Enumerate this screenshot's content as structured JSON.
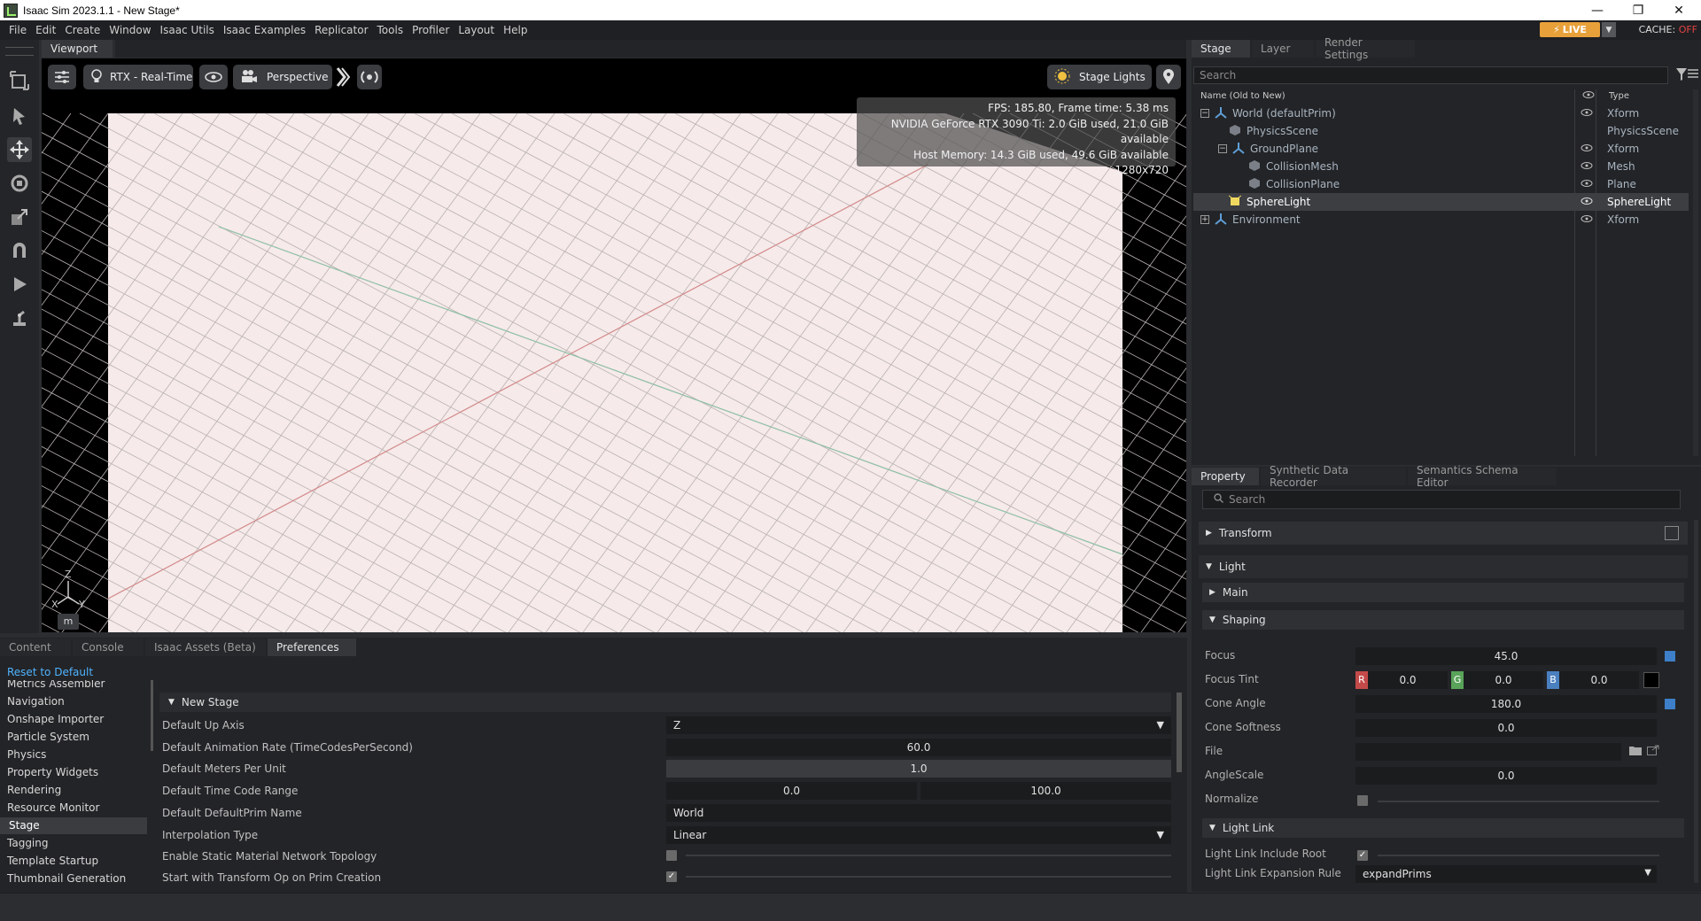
{
  "window": {
    "title": "Isaac Sim 2023.1.1 - New Stage*",
    "minimize": "—",
    "maximize": "❐",
    "close": "✕"
  },
  "menu": [
    "File",
    "Edit",
    "Create",
    "Window",
    "Isaac Utils",
    "Isaac Examples",
    "Replicator",
    "Tools",
    "Profiler",
    "Layout",
    "Help"
  ],
  "status": {
    "live": "LIVE",
    "cache_label": "CACHE:",
    "cache_state": "OFF"
  },
  "viewport": {
    "tab": "Viewport",
    "renderer": "RTX - Real-Time",
    "camera": "Perspective",
    "lights": "Stage Lights",
    "hud": {
      "fps": "FPS: 185.80, Frame time: 5.38 ms",
      "gpu": "NVIDIA GeForce RTX 3090 Ti: 2.0 GiB used, 21.0 GiB available",
      "host": "Host Memory: 14.3 GiB used, 49.6 GiB available",
      "resolution": "1280x720"
    },
    "axis": {
      "z": "Z",
      "x": "X",
      "y": "Y"
    },
    "unit": "m"
  },
  "stage": {
    "tabs": [
      "Stage",
      "Layer",
      "Render Settings"
    ],
    "search_placeholder": "Search",
    "col_name": "Name (Old to New)",
    "col_type": "Type",
    "rows": [
      {
        "name": "World (defaultPrim)",
        "type": "Xform"
      },
      {
        "name": "PhysicsScene",
        "type": "PhysicsScene"
      },
      {
        "name": "GroundPlane",
        "type": "Xform"
      },
      {
        "name": "CollisionMesh",
        "type": "Mesh"
      },
      {
        "name": "CollisionPlane",
        "type": "Plane"
      },
      {
        "name": "SphereLight",
        "type": "SphereLight"
      },
      {
        "name": "Environment",
        "type": "Xform"
      }
    ]
  },
  "property": {
    "tabs": [
      "Property",
      "Synthetic Data Recorder",
      "Semantics Schema Editor"
    ],
    "search_placeholder": "Search",
    "sections": {
      "transform": "Transform",
      "light": "Light",
      "main": "Main",
      "shaping": "Shaping",
      "light_link": "Light Link"
    },
    "fields": {
      "focus_label": "Focus",
      "focus": "45.0",
      "tint_label": "Focus Tint",
      "r": "R",
      "g": "G",
      "b": "B",
      "tint_r": "0.0",
      "tint_g": "0.0",
      "tint_b": "0.0",
      "cone_angle_label": "Cone Angle",
      "cone_angle": "180.0",
      "cone_softness_label": "Cone Softness",
      "cone_softness": "0.0",
      "file_label": "File",
      "angle_scale_label": "AngleScale",
      "angle_scale": "0.0",
      "normalize_label": "Normalize",
      "include_root_label": "Light Link Include Root",
      "expansion_rule_label": "Light Link Expansion Rule",
      "expansion_rule": "expandPrims"
    }
  },
  "bottom": {
    "tabs": [
      "Content",
      "Console",
      "Isaac Assets (Beta)",
      "Preferences"
    ],
    "reset": "Reset to Default",
    "nav": [
      "Metrics Assembler",
      "Navigation",
      "Onshape Importer",
      "Particle System",
      "Physics",
      "Property Widgets",
      "Rendering",
      "Resource Monitor",
      "Stage",
      "Tagging",
      "Template Startup",
      "Thumbnail Generation"
    ],
    "section_title": "New Stage",
    "prefs": {
      "up_axis_label": "Default Up Axis",
      "up_axis": "Z",
      "anim_rate_label": "Default Animation Rate (TimeCodesPerSecond)",
      "anim_rate": "60.0",
      "mpu_label": "Default Meters Per Unit",
      "mpu": "1.0",
      "tcr_label": "Default Time Code Range",
      "tcr_start": "0.0",
      "tcr_end": "100.0",
      "prim_label": "Default DefaultPrim Name",
      "prim": "World",
      "interp_label": "Interpolation Type",
      "interp": "Linear",
      "static_mat_label": "Enable Static Material Network Topology",
      "xform_op_label": "Start with Transform Op on Prim Creation"
    }
  },
  "colors": {
    "accent": "#e8a13a",
    "selected": "#3c3e42",
    "link": "#4fb3ff"
  }
}
